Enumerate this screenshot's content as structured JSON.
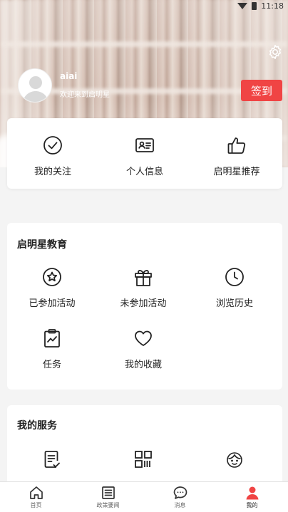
{
  "status_bar": {
    "time": "11:18"
  },
  "profile": {
    "username": "aiai",
    "welcome": "欢迎来到启明星",
    "signin_label": "签到"
  },
  "quick_actions": [
    {
      "label": "我的关注",
      "icon": "check-circle-icon"
    },
    {
      "label": "个人信息",
      "icon": "id-card-icon"
    },
    {
      "label": "启明星推荐",
      "icon": "thumbs-up-icon"
    }
  ],
  "education": {
    "title": "启明星教育",
    "items": [
      {
        "label": "已参加活动",
        "icon": "star-circle-icon"
      },
      {
        "label": "未参加活动",
        "icon": "gift-icon"
      },
      {
        "label": "浏览历史",
        "icon": "clock-icon"
      },
      {
        "label": "任务",
        "icon": "clipboard-chart-icon"
      },
      {
        "label": "我的收藏",
        "icon": "heart-icon"
      }
    ]
  },
  "services": {
    "title": "我的服务",
    "items": [
      {
        "icon": "document-check-icon"
      },
      {
        "icon": "qr-code-icon"
      },
      {
        "icon": "support-agent-icon"
      }
    ]
  },
  "tabbar": [
    {
      "label": "首页",
      "icon": "home-icon"
    },
    {
      "label": "政策要闻",
      "icon": "news-icon"
    },
    {
      "label": "消息",
      "icon": "chat-icon"
    },
    {
      "label": "我的",
      "icon": "user-icon",
      "active": true
    }
  ],
  "colors": {
    "accent": "#f04444",
    "text": "#222222",
    "background": "#f4f4f4"
  }
}
